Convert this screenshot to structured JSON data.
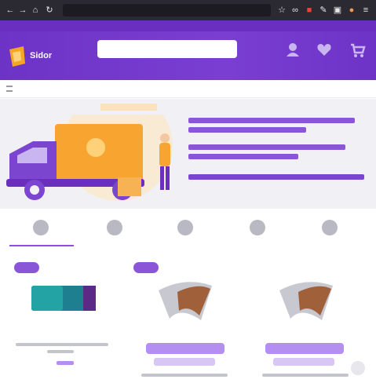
{
  "browser": {
    "icons": [
      "back-icon",
      "forward-icon",
      "home-icon",
      "reload-icon",
      "star-icon",
      "extensions-icon",
      "shield-icon",
      "tools-icon",
      "folder-icon",
      "profile-icon",
      "menu-icon"
    ]
  },
  "header": {
    "logo_text": "Sidor",
    "search_placeholder": "",
    "icons": [
      "account-icon",
      "wishlist-icon",
      "cart-icon"
    ]
  },
  "nav": {
    "categories_label": "",
    "links": [
      "",
      "",
      ""
    ],
    "right_links": [
      "",
      ""
    ]
  },
  "banner": {
    "lines": [
      "",
      "",
      "",
      "",
      "",
      ""
    ]
  },
  "features": [
    {
      "icon": "delivery-icon",
      "label": ""
    },
    {
      "icon": "box-icon",
      "label": ""
    },
    {
      "icon": "money-icon",
      "label": ""
    },
    {
      "icon": "lock-icon",
      "label": ""
    },
    {
      "icon": "support-icon",
      "label": ""
    }
  ],
  "products": [
    {
      "badge": "",
      "title": "",
      "price": "",
      "button": ""
    },
    {
      "badge": "",
      "title": "",
      "price": "",
      "button": ""
    },
    {
      "badge": "",
      "title": "",
      "price": "",
      "button": ""
    }
  ],
  "colors": {
    "brand": "#6d33c6",
    "accent": "#f59a1b",
    "button": "#b48ef0"
  }
}
